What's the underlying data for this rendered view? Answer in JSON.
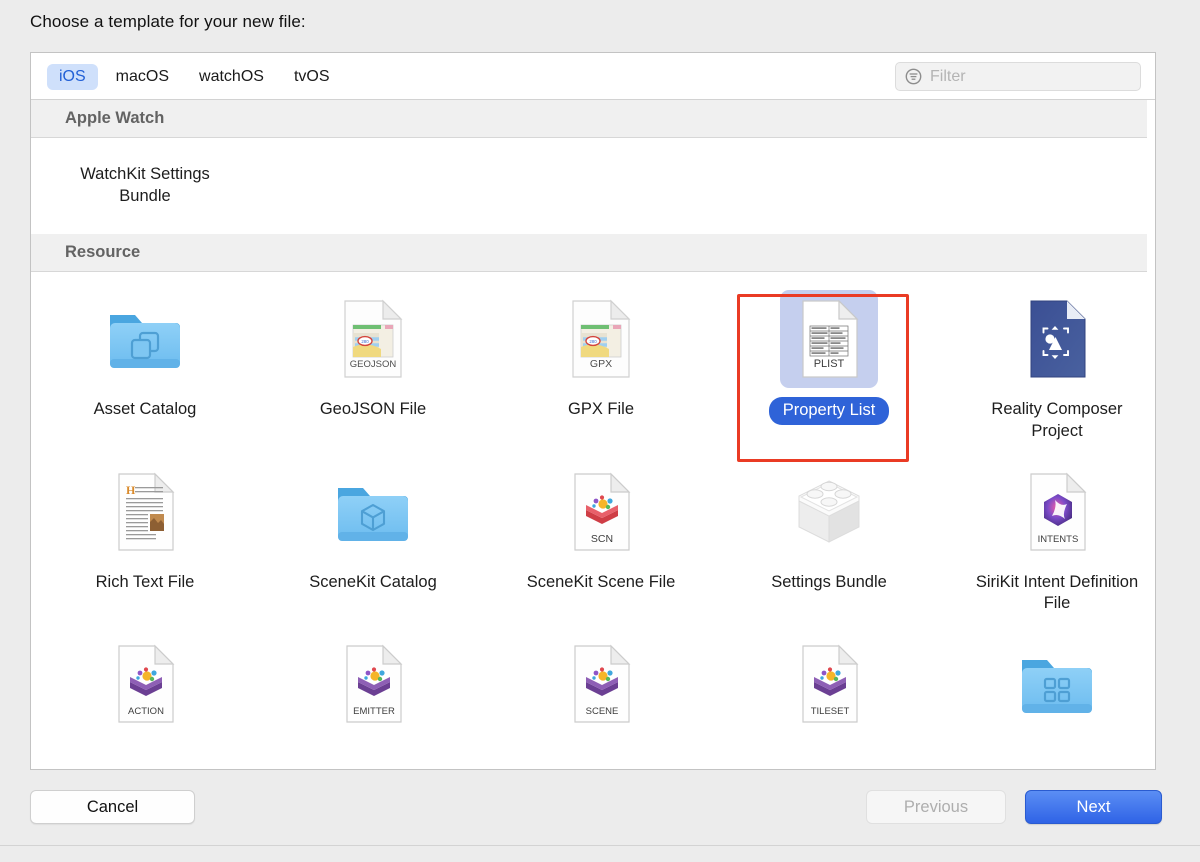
{
  "dialog": {
    "prompt": "Choose a template for your new file:"
  },
  "tabs": [
    {
      "label": "iOS",
      "selected": true
    },
    {
      "label": "macOS",
      "selected": false
    },
    {
      "label": "watchOS",
      "selected": false
    },
    {
      "label": "tvOS",
      "selected": false
    }
  ],
  "filter": {
    "placeholder": "Filter",
    "value": "",
    "icon": "filter-icon"
  },
  "sections": [
    {
      "title": "Apple Watch",
      "items": [
        {
          "label": "WatchKit Settings Bundle",
          "icon": "none",
          "selected": false
        }
      ]
    },
    {
      "title": "Resource",
      "items": [
        {
          "label": "Asset Catalog",
          "icon": "blue-folder-stacked-squares-icon",
          "selected": false
        },
        {
          "label": "GeoJSON File",
          "icon": "geojson-document-icon",
          "badge": "GEOJSON",
          "selected": false
        },
        {
          "label": "GPX File",
          "icon": "gpx-document-icon",
          "badge": "GPX",
          "selected": false
        },
        {
          "label": "Property List",
          "icon": "plist-document-icon",
          "badge": "PLIST",
          "selected": true
        },
        {
          "label": "Reality Composer Project",
          "icon": "reality-composer-document-icon",
          "selected": false
        },
        {
          "label": "Rich Text File",
          "icon": "rich-text-document-icon",
          "selected": false
        },
        {
          "label": "SceneKit Catalog",
          "icon": "blue-folder-cube-icon",
          "selected": false
        },
        {
          "label": "SceneKit Scene File",
          "icon": "scenekit-document-icon",
          "badge": "SCN",
          "selected": false
        },
        {
          "label": "Settings Bundle",
          "icon": "white-plugin-block-icon",
          "selected": false
        },
        {
          "label": "SiriKit Intent Definition File",
          "icon": "sirikit-intents-document-icon",
          "badge": "INTENTS",
          "selected": false
        },
        {
          "label": "",
          "icon": "spritekit-action-document-icon",
          "badge": "ACTION",
          "selected": false
        },
        {
          "label": "",
          "icon": "spritekit-emitter-document-icon",
          "badge": "EMITTER",
          "selected": false
        },
        {
          "label": "",
          "icon": "spritekit-scene-document-icon",
          "badge": "SCENE",
          "selected": false
        },
        {
          "label": "",
          "icon": "spritekit-tileset-document-icon",
          "badge": "TILESET",
          "selected": false
        },
        {
          "label": "",
          "icon": "blue-folder-grid-icon",
          "selected": false
        }
      ]
    }
  ],
  "buttons": {
    "cancel": "Cancel",
    "previous": "Previous",
    "next": "Next"
  },
  "colors": {
    "accent_blue": "#2f63d8",
    "next_button_blue": "#3b74ef",
    "selection_tint": "#c5cfee",
    "tab_selected_bg": "#cfe0fb",
    "annotation_red": "#ea3b24",
    "panel_bg": "#ffffff",
    "dialog_bg": "#ececec"
  }
}
